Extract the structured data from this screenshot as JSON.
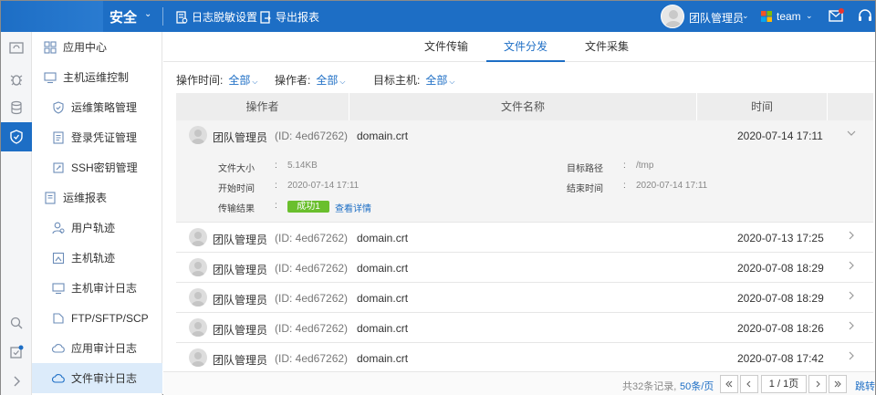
{
  "header": {
    "section": "安全",
    "tools": [
      {
        "label": "日志脱敏设置"
      },
      {
        "label": "导出报表"
      }
    ],
    "user": "团队管理员",
    "team": "team"
  },
  "sidebar": {
    "items": [
      {
        "label": "应用中心"
      },
      {
        "label": "主机运维控制"
      },
      {
        "label": "运维策略管理"
      },
      {
        "label": "登录凭证管理"
      },
      {
        "label": "SSH密钥管理"
      },
      {
        "label": "运维报表"
      },
      {
        "label": "用户轨迹"
      },
      {
        "label": "主机轨迹"
      },
      {
        "label": "主机审计日志"
      },
      {
        "label": "FTP/SFTP/SCP"
      },
      {
        "label": "应用审计日志"
      },
      {
        "label": "文件审计日志"
      }
    ]
  },
  "tabs": [
    {
      "label": "文件传输"
    },
    {
      "label": "文件分发"
    },
    {
      "label": "文件采集"
    }
  ],
  "filters": {
    "time_label": "操作时间:",
    "time_value": "全部",
    "operator_label": "操作者:",
    "operator_value": "全部",
    "host_label": "目标主机:",
    "host_value": "全部"
  },
  "table": {
    "columns": [
      "操作者",
      "文件名称",
      "时间"
    ],
    "rows": [
      {
        "operator": "团队管理员",
        "id": "(ID: 4ed67262)",
        "file": "domain.crt",
        "time": "2020-07-14 17:11"
      },
      {
        "operator": "团队管理员",
        "id": "(ID: 4ed67262)",
        "file": "domain.crt",
        "time": "2020-07-13 17:25"
      },
      {
        "operator": "团队管理员",
        "id": "(ID: 4ed67262)",
        "file": "domain.crt",
        "time": "2020-07-08 18:29"
      },
      {
        "operator": "团队管理员",
        "id": "(ID: 4ed67262)",
        "file": "domain.crt",
        "time": "2020-07-08 18:29"
      },
      {
        "operator": "团队管理员",
        "id": "(ID: 4ed67262)",
        "file": "domain.crt",
        "time": "2020-07-08 18:26"
      },
      {
        "operator": "团队管理员",
        "id": "(ID: 4ed67262)",
        "file": "domain.crt",
        "time": "2020-07-08 17:42"
      }
    ],
    "detail": {
      "size_label": "文件大小",
      "size_value": "5.14KB",
      "start_label": "开始时间",
      "start_value": "2020-07-14 17:11",
      "result_label": "传输结果",
      "result_badge": "成功1",
      "result_link": "查看详情",
      "path_label": "目标路径",
      "path_value": "/tmp",
      "end_label": "结束时间",
      "end_value": "2020-07-14 17:11"
    }
  },
  "pagination": {
    "total": "共32条记录,",
    "page_size": "50条/页",
    "page_info": "1 / 1页",
    "jump": "跳转"
  },
  "colors": {
    "primary": "#1d6ec5",
    "success": "#6abf2d",
    "sidebar_active": "#dcebfa"
  }
}
